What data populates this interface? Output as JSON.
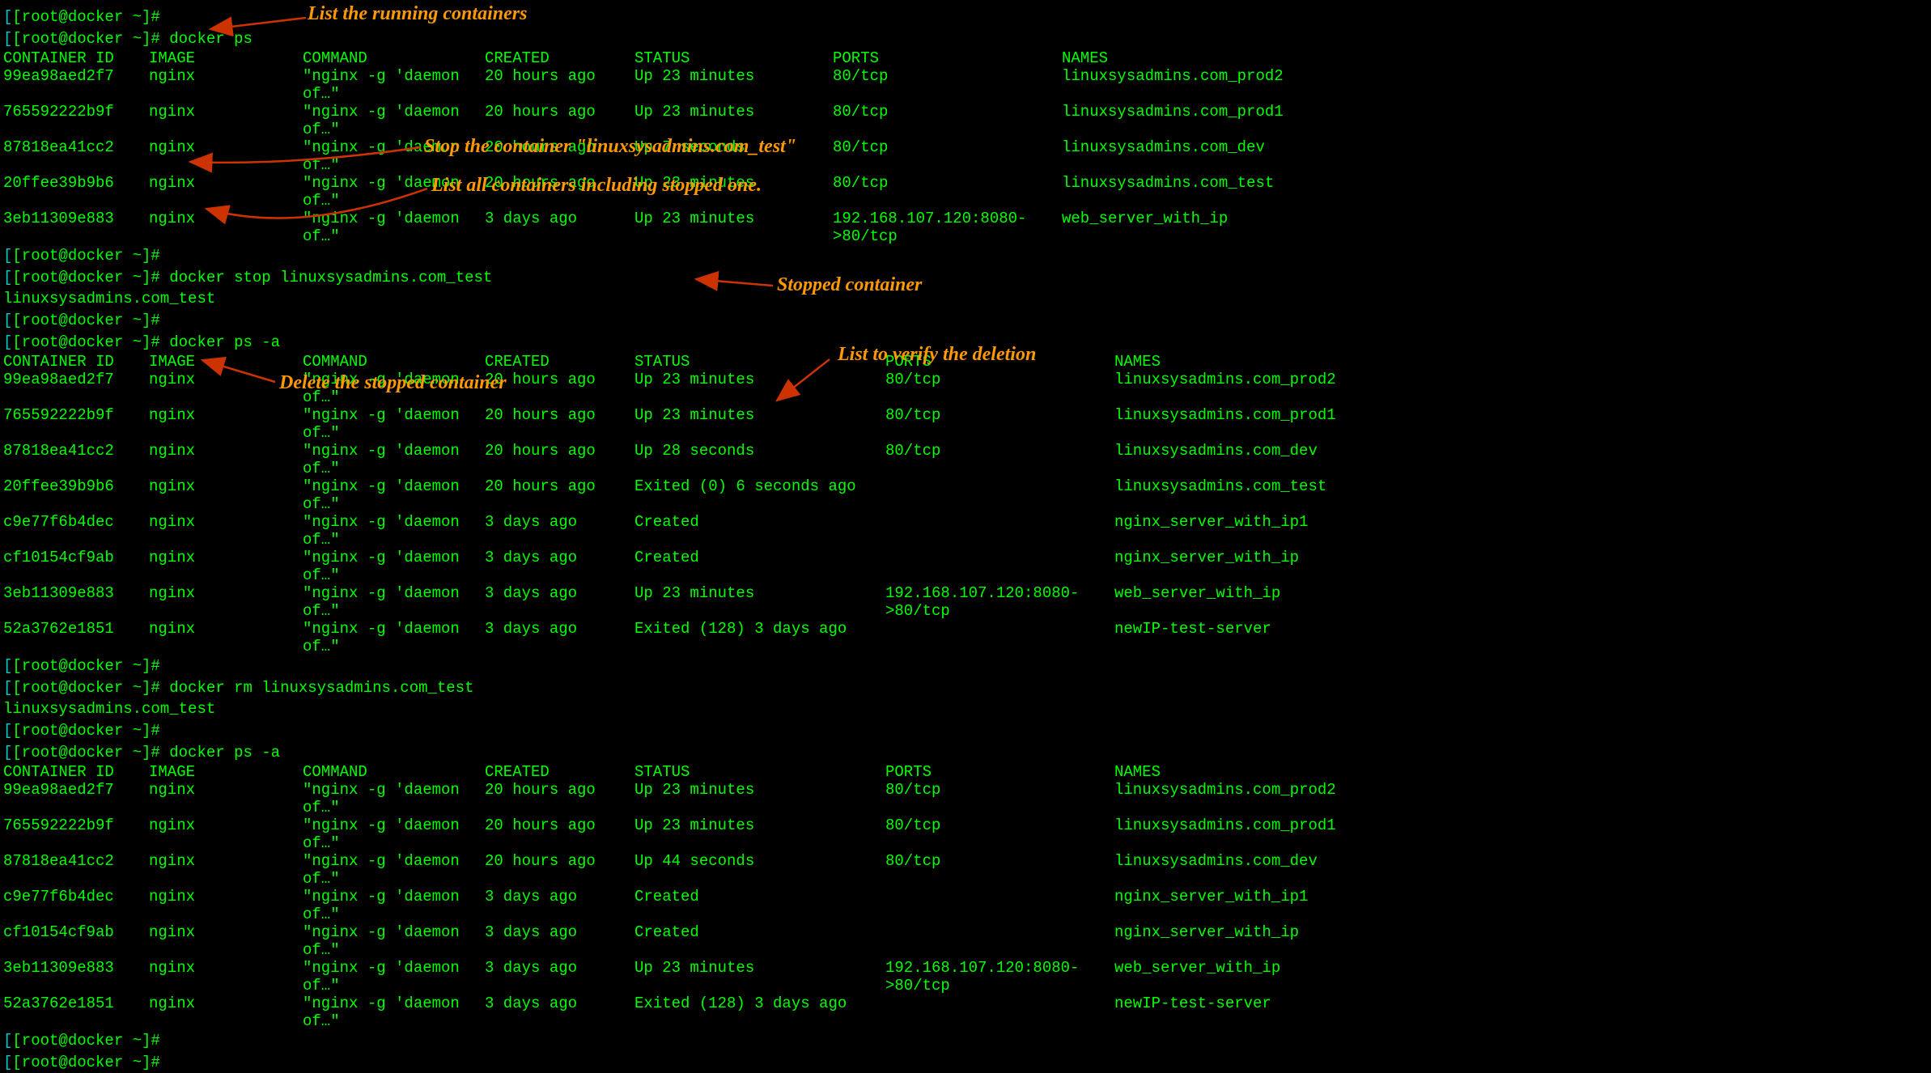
{
  "prompt": "[root@docker ~]#",
  "commands": {
    "ps": "docker ps",
    "stop": "docker stop linuxsysadmins.com_test",
    "psa": "docker ps -a",
    "rm": "docker rm linuxsysadmins.com_test"
  },
  "outputs": {
    "stop_result": "linuxsysadmins.com_test",
    "rm_result": "linuxsysadmins.com_test"
  },
  "headers": {
    "id": "CONTAINER ID",
    "image": "IMAGE",
    "command": "COMMAND",
    "created": "CREATED",
    "status": "STATUS",
    "ports": "PORTS",
    "names": "NAMES"
  },
  "cmd_text": "\"nginx -g 'daemon of…\"",
  "table1": [
    {
      "id": "99ea98aed2f7",
      "image": "nginx",
      "created": "20 hours ago",
      "status": "Up 23 minutes",
      "ports": "80/tcp",
      "names": "linuxsysadmins.com_prod2"
    },
    {
      "id": "765592222b9f",
      "image": "nginx",
      "created": "20 hours ago",
      "status": "Up 23 minutes",
      "ports": "80/tcp",
      "names": "linuxsysadmins.com_prod1"
    },
    {
      "id": "87818ea41cc2",
      "image": "nginx",
      "created": "20 hours ago",
      "status": "Up 7 seconds",
      "ports": "80/tcp",
      "names": "linuxsysadmins.com_dev"
    },
    {
      "id": "20ffee39b9b6",
      "image": "nginx",
      "created": "20 hours ago",
      "status": "Up 23 minutes",
      "ports": "80/tcp",
      "names": "linuxsysadmins.com_test"
    },
    {
      "id": "3eb11309e883",
      "image": "nginx",
      "created": "3 days ago",
      "status": "Up 23 minutes",
      "ports": "192.168.107.120:8080->80/tcp",
      "names": "web_server_with_ip"
    }
  ],
  "table2": [
    {
      "id": "99ea98aed2f7",
      "image": "nginx",
      "created": "20 hours ago",
      "status": "Up 23 minutes",
      "ports": "80/tcp",
      "names": "linuxsysadmins.com_prod2"
    },
    {
      "id": "765592222b9f",
      "image": "nginx",
      "created": "20 hours ago",
      "status": "Up 23 minutes",
      "ports": "80/tcp",
      "names": "linuxsysadmins.com_prod1"
    },
    {
      "id": "87818ea41cc2",
      "image": "nginx",
      "created": "20 hours ago",
      "status": "Up 28 seconds",
      "ports": "80/tcp",
      "names": "linuxsysadmins.com_dev"
    },
    {
      "id": "20ffee39b9b6",
      "image": "nginx",
      "created": "20 hours ago",
      "status": "Exited (0) 6 seconds ago",
      "ports": "",
      "names": "linuxsysadmins.com_test"
    },
    {
      "id": "c9e77f6b4dec",
      "image": "nginx",
      "created": "3 days ago",
      "status": "Created",
      "ports": "",
      "names": "nginx_server_with_ip1"
    },
    {
      "id": "cf10154cf9ab",
      "image": "nginx",
      "created": "3 days ago",
      "status": "Created",
      "ports": "",
      "names": "nginx_server_with_ip"
    },
    {
      "id": "3eb11309e883",
      "image": "nginx",
      "created": "3 days ago",
      "status": "Up 23 minutes",
      "ports": "192.168.107.120:8080->80/tcp",
      "names": "web_server_with_ip"
    },
    {
      "id": "52a3762e1851",
      "image": "nginx",
      "created": "3 days ago",
      "status": "Exited (128) 3 days ago",
      "ports": "",
      "names": "newIP-test-server"
    }
  ],
  "table3": [
    {
      "id": "99ea98aed2f7",
      "image": "nginx",
      "created": "20 hours ago",
      "status": "Up 23 minutes",
      "ports": "80/tcp",
      "names": "linuxsysadmins.com_prod2"
    },
    {
      "id": "765592222b9f",
      "image": "nginx",
      "created": "20 hours ago",
      "status": "Up 23 minutes",
      "ports": "80/tcp",
      "names": "linuxsysadmins.com_prod1"
    },
    {
      "id": "87818ea41cc2",
      "image": "nginx",
      "created": "20 hours ago",
      "status": "Up 44 seconds",
      "ports": "80/tcp",
      "names": "linuxsysadmins.com_dev"
    },
    {
      "id": "c9e77f6b4dec",
      "image": "nginx",
      "created": "3 days ago",
      "status": "Created",
      "ports": "",
      "names": "nginx_server_with_ip1"
    },
    {
      "id": "cf10154cf9ab",
      "image": "nginx",
      "created": "3 days ago",
      "status": "Created",
      "ports": "",
      "names": "nginx_server_with_ip"
    },
    {
      "id": "3eb11309e883",
      "image": "nginx",
      "created": "3 days ago",
      "status": "Up 23 minutes",
      "ports": "192.168.107.120:8080->80/tcp",
      "names": "web_server_with_ip"
    },
    {
      "id": "52a3762e1851",
      "image": "nginx",
      "created": "3 days ago",
      "status": "Exited (128) 3 days ago",
      "ports": "",
      "names": "newIP-test-server"
    }
  ],
  "annotations": {
    "a1": "List the running containers",
    "a2": "Stop the container \"linuxsysadmins.com_test\"",
    "a3": "List all containers including stopped one.",
    "a4": "Stopped container",
    "a5": "Delete the stopped container",
    "a6": "List to verify the deletion"
  }
}
